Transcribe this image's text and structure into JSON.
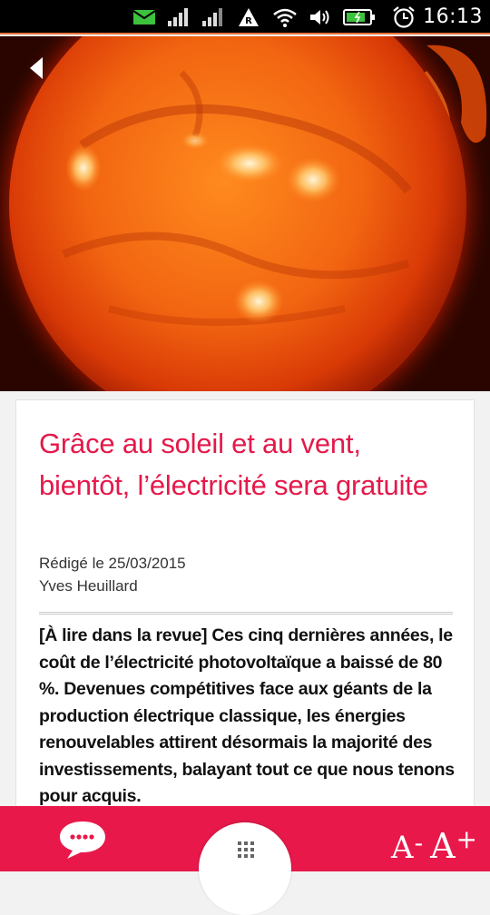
{
  "status_bar": {
    "time": "16:13",
    "icons": [
      "email-icon",
      "signal-icon",
      "signal-icon",
      "roaming-icon",
      "wifi-icon",
      "volume-icon",
      "battery-icon",
      "alarm-icon"
    ]
  },
  "hero": {
    "image": "sun-photo",
    "back_icon": "back-arrow-icon"
  },
  "article": {
    "title": "Grâce au soleil et au vent, bientôt, l’électricité sera gratuite",
    "date_line": "Rédigé le 25/03/2015",
    "author": "Yves Heuillard",
    "lead": "[À lire dans la revue] Ces cinq dernières années, le coût de l’électricité photovoltaïque a baissé de 80 %. Devenues compétitives face aux géants de la production électrique classique, les énergies renouvelables attirent désormais la majorité des investissements, balayant tout ce que nous tenons pour acquis."
  },
  "bottom_bar": {
    "comments_icon": "chat-bubble-icon",
    "menu_icon": "grid-dots-icon",
    "font_decrease": "A",
    "font_decrease_sign": "-",
    "font_increase": "A",
    "font_increase_sign": "+"
  },
  "colors": {
    "accent": "#e8194a",
    "title": "#e4194a",
    "status_accent": "#e8703a"
  }
}
